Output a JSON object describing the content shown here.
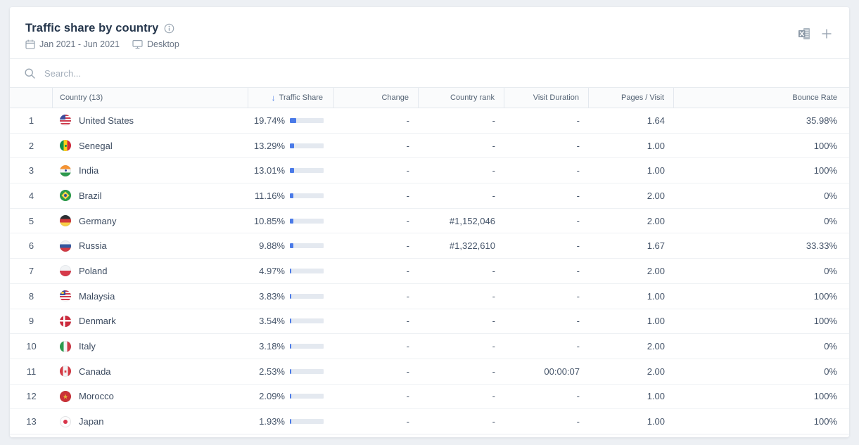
{
  "header": {
    "title": "Traffic share by country",
    "date_range": "Jan 2021 - Jun 2021",
    "device": "Desktop"
  },
  "toolbar": {
    "icons": [
      "excel-export-icon",
      "plus-icon"
    ]
  },
  "search": {
    "placeholder": "Search..."
  },
  "table": {
    "sort_indicator": "↓",
    "sorted_by": "Traffic Share",
    "columns": {
      "rank": "",
      "country": "Country (13)",
      "traffic_share": "Traffic Share",
      "change": "Change",
      "country_rank": "Country rank",
      "visit_duration": "Visit Duration",
      "pages_per_visit": "Pages / Visit",
      "bounce_rate": "Bounce Rate"
    },
    "rows": [
      {
        "rank": "1",
        "country": "United States",
        "flag": "us",
        "traffic_share": "19.74%",
        "share_value": 19.74,
        "change": "-",
        "country_rank": "-",
        "visit_duration": "-",
        "pages_per_visit": "1.64",
        "bounce_rate": "35.98%"
      },
      {
        "rank": "2",
        "country": "Senegal",
        "flag": "sn",
        "traffic_share": "13.29%",
        "share_value": 13.29,
        "change": "-",
        "country_rank": "-",
        "visit_duration": "-",
        "pages_per_visit": "1.00",
        "bounce_rate": "100%"
      },
      {
        "rank": "3",
        "country": "India",
        "flag": "in",
        "traffic_share": "13.01%",
        "share_value": 13.01,
        "change": "-",
        "country_rank": "-",
        "visit_duration": "-",
        "pages_per_visit": "1.00",
        "bounce_rate": "100%"
      },
      {
        "rank": "4",
        "country": "Brazil",
        "flag": "br",
        "traffic_share": "11.16%",
        "share_value": 11.16,
        "change": "-",
        "country_rank": "-",
        "visit_duration": "-",
        "pages_per_visit": "2.00",
        "bounce_rate": "0%"
      },
      {
        "rank": "5",
        "country": "Germany",
        "flag": "de",
        "traffic_share": "10.85%",
        "share_value": 10.85,
        "change": "-",
        "country_rank": "#1,152,046",
        "visit_duration": "-",
        "pages_per_visit": "2.00",
        "bounce_rate": "0%"
      },
      {
        "rank": "6",
        "country": "Russia",
        "flag": "ru",
        "traffic_share": "9.88%",
        "share_value": 9.88,
        "change": "-",
        "country_rank": "#1,322,610",
        "visit_duration": "-",
        "pages_per_visit": "1.67",
        "bounce_rate": "33.33%"
      },
      {
        "rank": "7",
        "country": "Poland",
        "flag": "pl",
        "traffic_share": "4.97%",
        "share_value": 4.97,
        "change": "-",
        "country_rank": "-",
        "visit_duration": "-",
        "pages_per_visit": "2.00",
        "bounce_rate": "0%"
      },
      {
        "rank": "8",
        "country": "Malaysia",
        "flag": "my",
        "traffic_share": "3.83%",
        "share_value": 3.83,
        "change": "-",
        "country_rank": "-",
        "visit_duration": "-",
        "pages_per_visit": "1.00",
        "bounce_rate": "100%"
      },
      {
        "rank": "9",
        "country": "Denmark",
        "flag": "dk",
        "traffic_share": "3.54%",
        "share_value": 3.54,
        "change": "-",
        "country_rank": "-",
        "visit_duration": "-",
        "pages_per_visit": "1.00",
        "bounce_rate": "100%"
      },
      {
        "rank": "10",
        "country": "Italy",
        "flag": "it",
        "traffic_share": "3.18%",
        "share_value": 3.18,
        "change": "-",
        "country_rank": "-",
        "visit_duration": "-",
        "pages_per_visit": "2.00",
        "bounce_rate": "0%"
      },
      {
        "rank": "11",
        "country": "Canada",
        "flag": "ca",
        "traffic_share": "2.53%",
        "share_value": 2.53,
        "change": "-",
        "country_rank": "-",
        "visit_duration": "00:00:07",
        "pages_per_visit": "2.00",
        "bounce_rate": "0%"
      },
      {
        "rank": "12",
        "country": "Morocco",
        "flag": "ma",
        "traffic_share": "2.09%",
        "share_value": 2.09,
        "change": "-",
        "country_rank": "-",
        "visit_duration": "-",
        "pages_per_visit": "1.00",
        "bounce_rate": "100%"
      },
      {
        "rank": "13",
        "country": "Japan",
        "flag": "jp",
        "traffic_share": "1.93%",
        "share_value": 1.93,
        "change": "-",
        "country_rank": "-",
        "visit_duration": "-",
        "pages_per_visit": "1.00",
        "bounce_rate": "100%"
      }
    ]
  }
}
